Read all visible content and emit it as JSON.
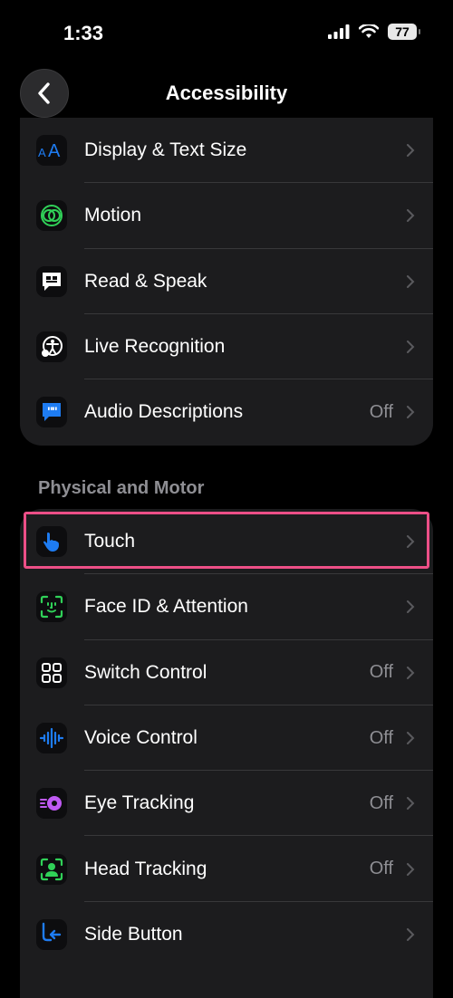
{
  "status": {
    "time": "1:33",
    "battery": "77"
  },
  "nav": {
    "title": "Accessibility"
  },
  "group1": [
    {
      "label": "Display & Text Size",
      "value": "",
      "icon": "text-size-icon"
    },
    {
      "label": "Motion",
      "value": "",
      "icon": "motion-icon"
    },
    {
      "label": "Read & Speak",
      "value": "",
      "icon": "speech-bubble-icon"
    },
    {
      "label": "Live Recognition",
      "value": "",
      "icon": "accessibility-person-icon"
    },
    {
      "label": "Audio Descriptions",
      "value": "Off",
      "icon": "quote-bubble-icon"
    }
  ],
  "section2_header": "Physical and Motor",
  "group2": [
    {
      "label": "Touch",
      "value": "",
      "icon": "hand-pointer-icon"
    },
    {
      "label": "Face ID & Attention",
      "value": "",
      "icon": "face-id-icon"
    },
    {
      "label": "Switch Control",
      "value": "Off",
      "icon": "grid-icon"
    },
    {
      "label": "Voice Control",
      "value": "Off",
      "icon": "waveform-icon"
    },
    {
      "label": "Eye Tracking",
      "value": "Off",
      "icon": "eye-tracking-icon"
    },
    {
      "label": "Head Tracking",
      "value": "Off",
      "icon": "head-tracking-icon"
    },
    {
      "label": "Side Button",
      "value": "",
      "icon": "side-button-icon"
    }
  ],
  "colors": {
    "highlight": "#ec4f87",
    "accent_blue": "#1e7cf2",
    "accent_green": "#30d158",
    "accent_purple": "#bf5af2"
  }
}
